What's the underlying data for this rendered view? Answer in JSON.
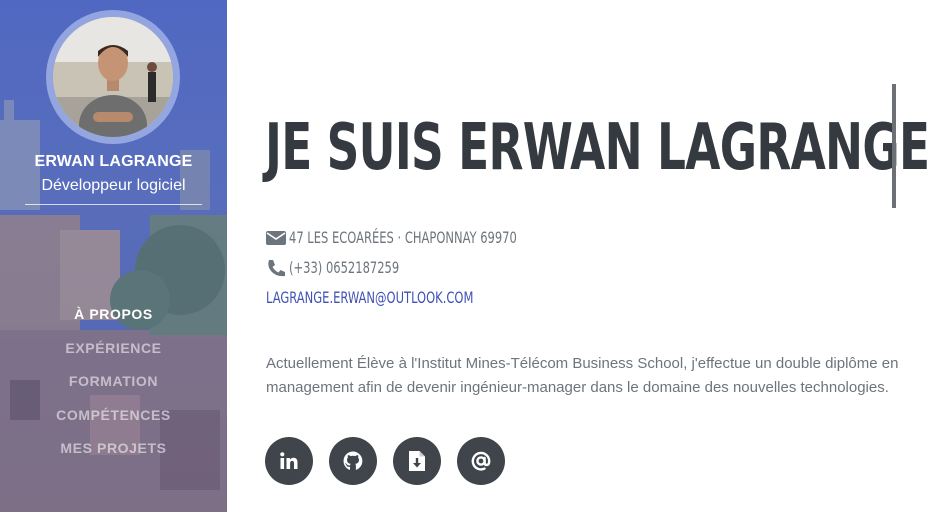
{
  "sidebar": {
    "name": "ERWAN LAGRANGE",
    "role": "Développeur logiciel",
    "nav": [
      {
        "label": "À PROPOS",
        "active": true
      },
      {
        "label": "EXPÉRIENCE",
        "active": false
      },
      {
        "label": "FORMATION",
        "active": false
      },
      {
        "label": "COMPÉTENCES",
        "active": false
      },
      {
        "label": "MES PROJETS",
        "active": false
      }
    ]
  },
  "main": {
    "heading": "JE SUIS ERWAN LAGRANGE",
    "address": "47 LES ECOARÉES · CHAPONNAY 69970",
    "phone": "(+33) 0652187259",
    "email": "LAGRANGE.ERWAN@OUTLOOK.COM",
    "bio": "Actuellement Élève à l'Institut Mines-Télécom Business School, j'effectue un double diplôme en management afin de devenir ingénieur-manager dans le domaine des nouvelles technologies.",
    "social": [
      {
        "icon": "linkedin-icon",
        "glyph": "in"
      },
      {
        "icon": "github-icon"
      },
      {
        "icon": "file-download-icon"
      },
      {
        "icon": "at-icon",
        "glyph": "@"
      }
    ]
  },
  "colors": {
    "sidebar": "#5468c0",
    "heading": "#343a40",
    "muted": "#6c757d",
    "link": "#3f51b5",
    "social_bg": "#3f454b"
  }
}
